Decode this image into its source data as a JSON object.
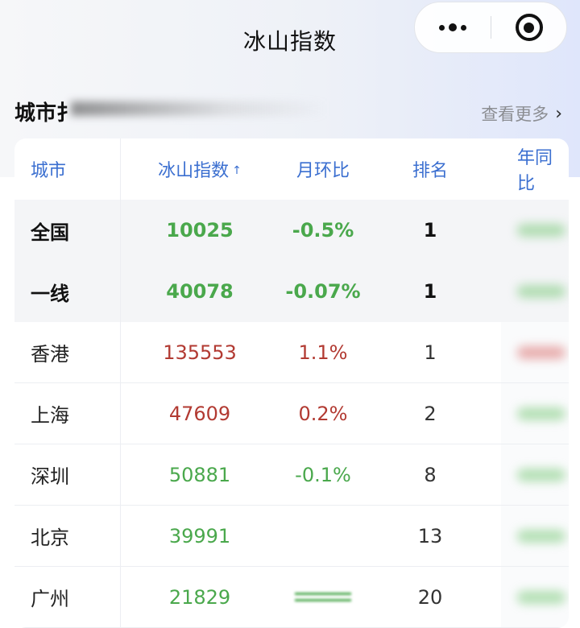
{
  "nav": {
    "title": "冰山指数"
  },
  "section": {
    "title": "城市扌",
    "see_more": "查看更多",
    "see_more_icon": "chevron-right-icon"
  },
  "table": {
    "headers": {
      "city": "城市",
      "index": "冰山指数",
      "mom": "月环比",
      "rank": "排名",
      "yoy": "年同比"
    },
    "sort_icon": "↑",
    "rows": [
      {
        "city": "全国",
        "index": "10025",
        "mom": "-0.5%",
        "rank": "1"
      },
      {
        "city": "一线",
        "index": "40078",
        "mom": "-0.07%",
        "rank": "1"
      },
      {
        "city": "香港",
        "index": "135553",
        "mom": "1.1%",
        "rank": "1"
      },
      {
        "city": "上海",
        "index": "47609",
        "mom": "0.2%",
        "rank": "2"
      },
      {
        "city": "深圳",
        "index": "50881",
        "mom": "-0.1%",
        "rank": "8"
      },
      {
        "city": "北京",
        "index": "39991",
        "mom": "",
        "rank": "13"
      },
      {
        "city": "广州",
        "index": "21829",
        "mom": "",
        "rank": "20"
      }
    ]
  },
  "colors": {
    "header_blue": "#3b6fd0",
    "down_green": "#4aa84c",
    "up_red": "#b23a32"
  }
}
